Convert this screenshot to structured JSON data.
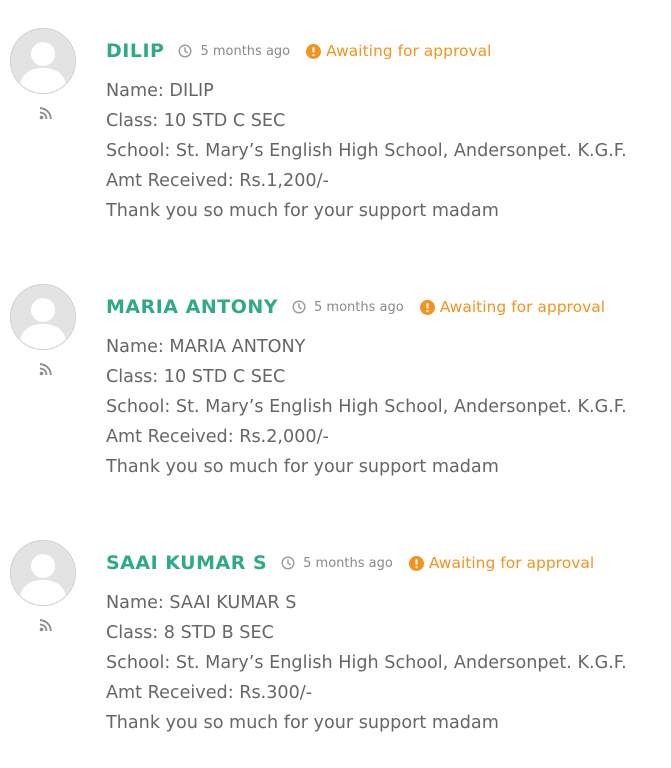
{
  "comments": [
    {
      "author": "DILIP",
      "time": "5 months ago",
      "status": "Awaiting for approval",
      "lines": [
        "Name: DILIP",
        "Class: 10 STD C SEC",
        "School: St. Mary’s English High School, Andersonpet. K.G.F.",
        "Amt Received: Rs.1,200/-",
        "Thank you so much for your support madam"
      ]
    },
    {
      "author": "MARIA ANTONY",
      "time": "5 months ago",
      "status": "Awaiting for approval",
      "lines": [
        "Name: MARIA ANTONY",
        "Class: 10 STD C SEC",
        "School: St. Mary’s English High School, Andersonpet. K.G.F.",
        "Amt Received: Rs.2,000/-",
        "Thank you so much for your support madam"
      ]
    },
    {
      "author": "SAAI KUMAR S",
      "time": "5 months ago",
      "status": "Awaiting for approval",
      "lines": [
        "Name: SAAI KUMAR S",
        "Class: 8 STD B SEC",
        "School: St. Mary’s English High School, Andersonpet. K.G.F.",
        "Amt Received: Rs.300/-",
        "Thank you so much for your support madam"
      ]
    }
  ],
  "icons": {
    "avatar": "default-avatar-icon",
    "feed": "rss-feed-icon",
    "time": "clock-icon",
    "status": "exclamation-circle-icon"
  },
  "colors": {
    "author": "#2eaa86",
    "status": "#f2941d",
    "text": "#666666",
    "meta": "#8a8a8a"
  }
}
